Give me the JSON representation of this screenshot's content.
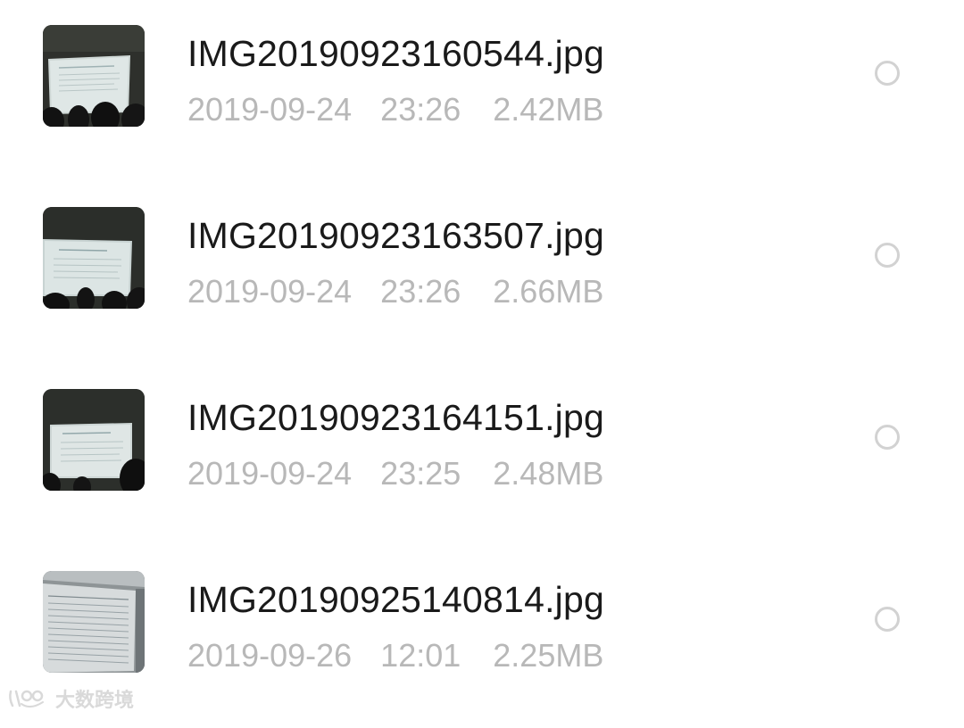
{
  "files": [
    {
      "name": "IMG20190923160544.jpg",
      "date": "2019-09-24",
      "time": "23:26",
      "size": "2.42MB",
      "selected": false,
      "thumbnail_icon": "photo-thumbnail-presentation"
    },
    {
      "name": "IMG20190923163507.jpg",
      "date": "2019-09-24",
      "time": "23:26",
      "size": "2.66MB",
      "selected": false,
      "thumbnail_icon": "photo-thumbnail-presentation"
    },
    {
      "name": "IMG20190923164151.jpg",
      "date": "2019-09-24",
      "time": "23:25",
      "size": "2.48MB",
      "selected": false,
      "thumbnail_icon": "photo-thumbnail-presentation"
    },
    {
      "name": "IMG20190925140814.jpg",
      "date": "2019-09-26",
      "time": "12:01",
      "size": "2.25MB",
      "selected": false,
      "thumbnail_icon": "photo-thumbnail-document"
    }
  ],
  "watermark": {
    "text": "大数跨境",
    "icon": "brand-logo-icon"
  },
  "colors": {
    "filename": "#1a1a1a",
    "meta": "#b8b8b8",
    "radio_border": "#d2d2d2",
    "background": "#ffffff"
  }
}
